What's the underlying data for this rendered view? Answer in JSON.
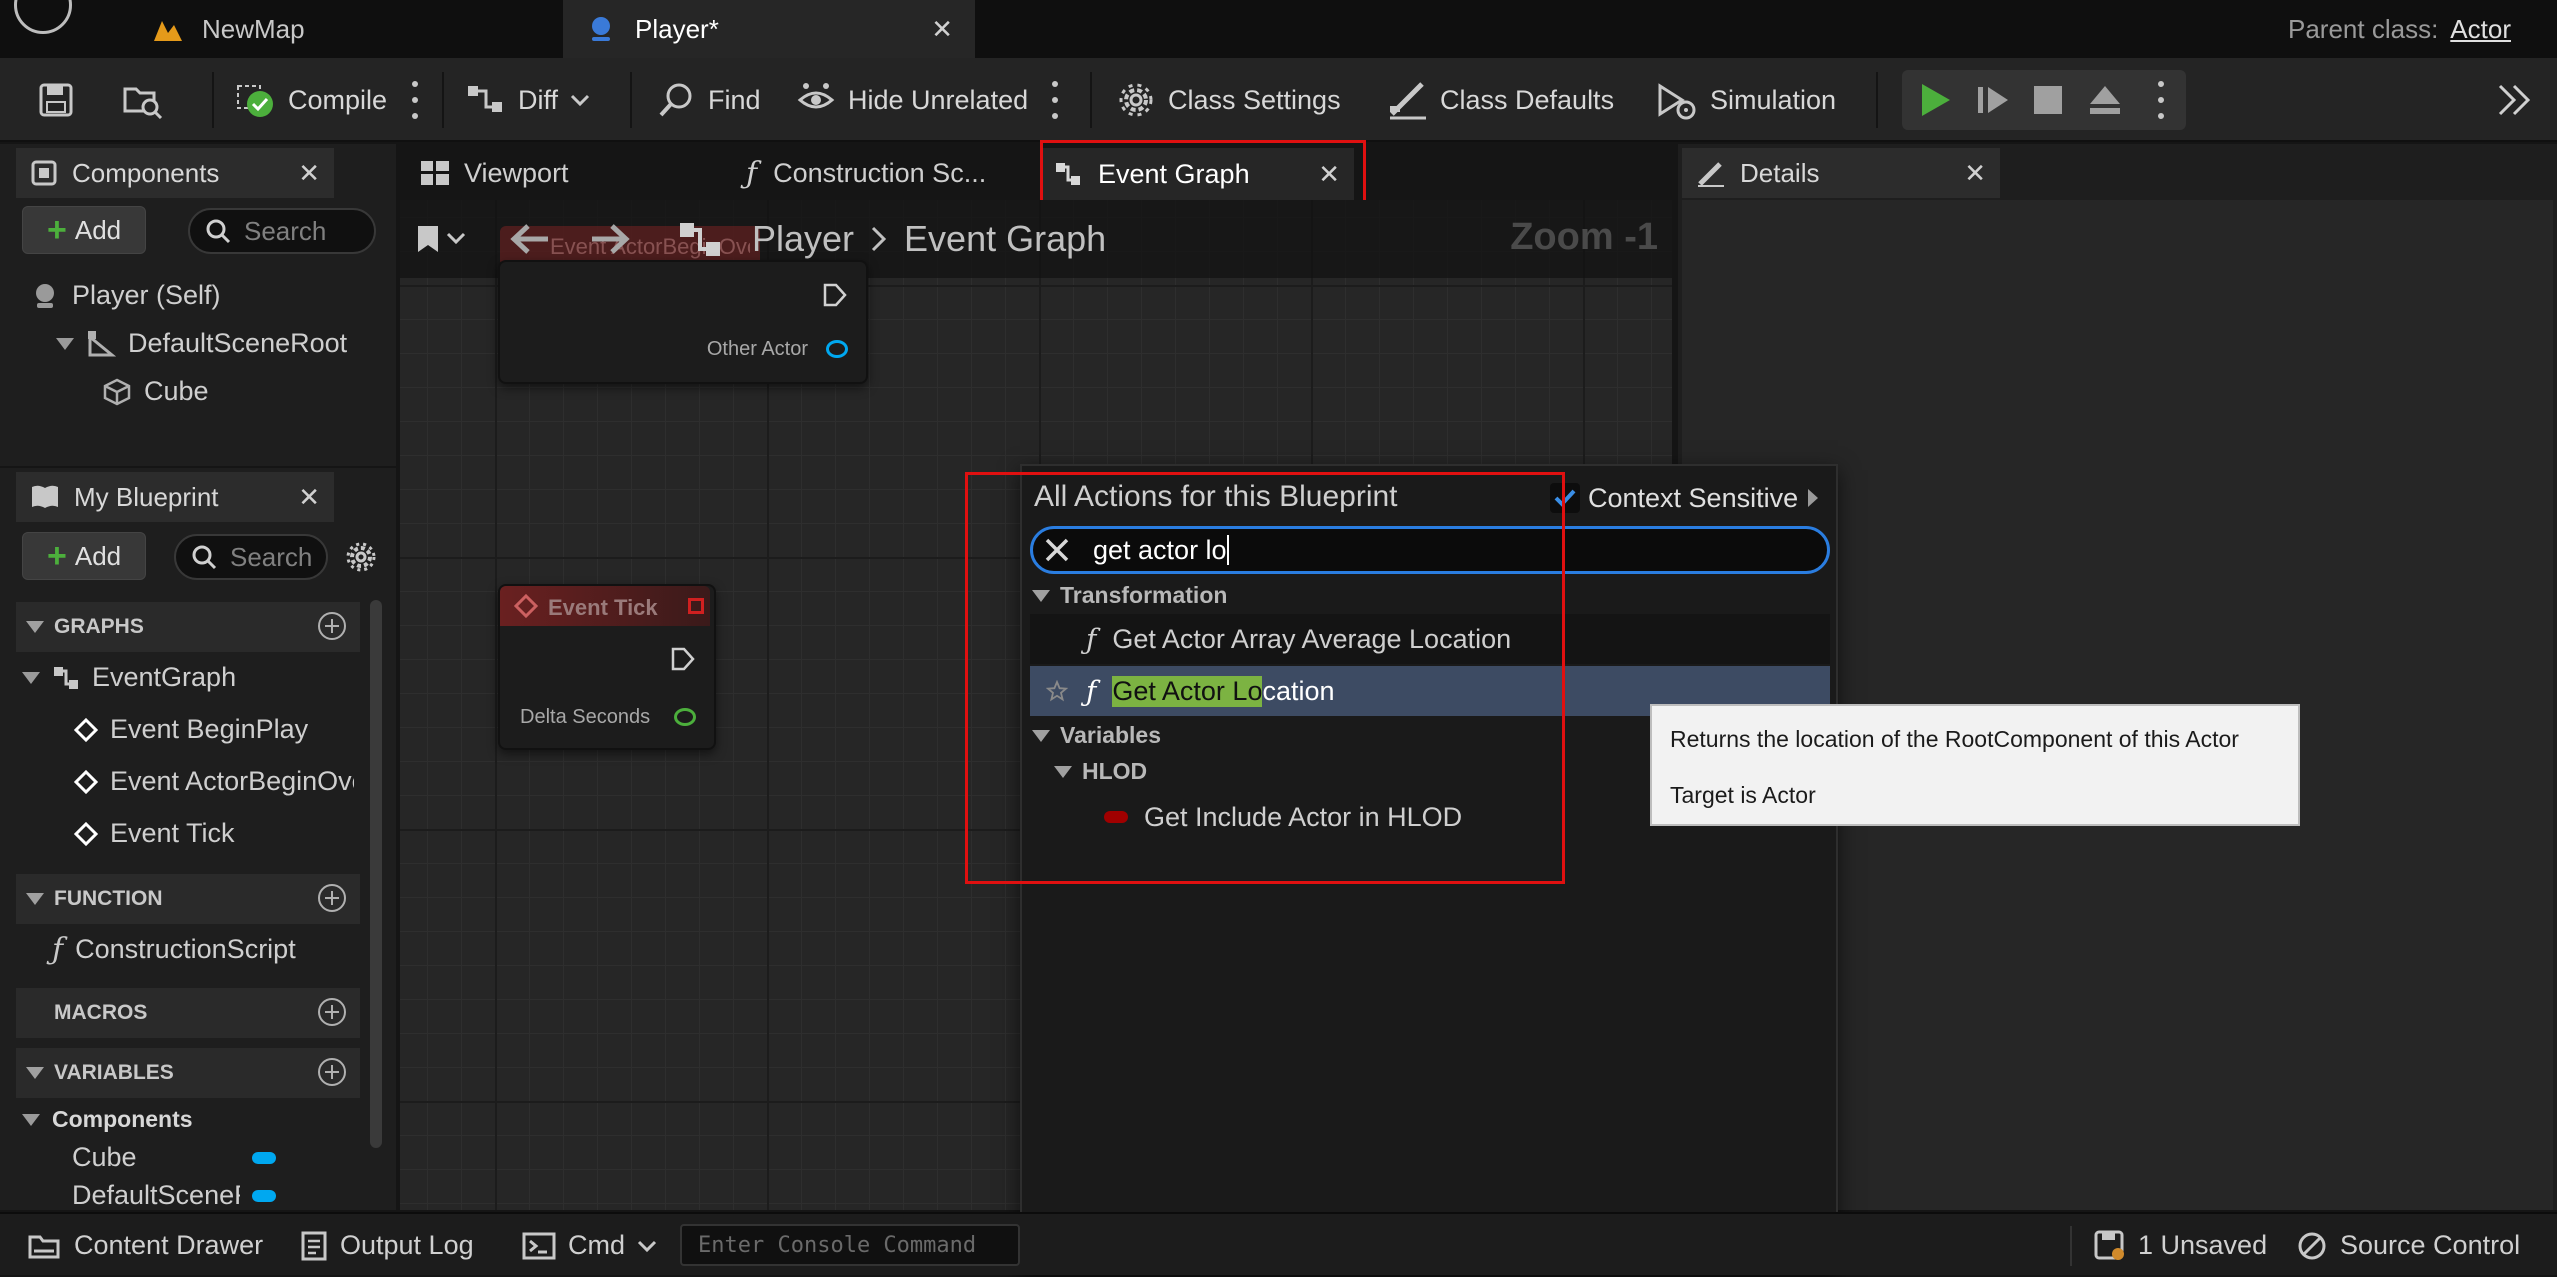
{
  "titlebar": {
    "tabs": [
      {
        "label": "NewMap"
      },
      {
        "label": "Player*"
      }
    ],
    "parent_class_label": "Parent class:",
    "parent_class_value": "Actor"
  },
  "toolbar": {
    "compile": "Compile",
    "diff": "Diff",
    "find": "Find",
    "hide_unrelated": "Hide Unrelated",
    "class_settings": "Class Settings",
    "class_defaults": "Class Defaults",
    "simulation": "Simulation"
  },
  "components_panel": {
    "title": "Components",
    "add_label": "Add",
    "search_placeholder": "Search",
    "tree": [
      "Player (Self)",
      "DefaultSceneRoot",
      "Cube"
    ]
  },
  "editor_tabs": [
    {
      "label": "Viewport"
    },
    {
      "label": "Construction Sc..."
    },
    {
      "label": "Event Graph"
    }
  ],
  "details_panel": {
    "title": "Details"
  },
  "graph": {
    "breadcrumb_root": "Player",
    "breadcrumb_leaf": "Event Graph",
    "zoom": "Zoom -1",
    "ghost_node_label": "Event ActorBeginOverlap",
    "node1_pin": "Other Actor",
    "node2_title": "Event Tick",
    "node2_pin": "Delta Seconds"
  },
  "my_blueprint": {
    "title": "My Blueprint",
    "add_label": "Add",
    "search_placeholder": "Search",
    "sections": {
      "graphs": "GRAPHS",
      "function": "FUNCTION",
      "macros": "MACROS",
      "variables": "VARIABLES"
    },
    "graphs_tree": [
      "EventGraph",
      "Event BeginPlay",
      "Event ActorBeginOverlap",
      "Event Tick"
    ],
    "functions_tree": [
      "ConstructionScript"
    ],
    "variables_category": "Components",
    "variables_tree": [
      "Cube",
      "DefaultSceneRoot"
    ]
  },
  "action_menu": {
    "title": "All Actions for this Blueprint",
    "context_sensitive": "Context Sensitive",
    "search_value": "get actor lo",
    "cat_transformation": "Transformation",
    "item1": "Get Actor Array Average Location",
    "item2_highlight": "Get Actor Lo",
    "item2_rest": "cation",
    "cat_variables": "Variables",
    "subcat_hlod": "HLOD",
    "item3": "Get Include Actor in HLOD"
  },
  "tooltip": {
    "line1": "Returns the location of the RootComponent of this Actor",
    "line2": "Target is Actor"
  },
  "statusbar": {
    "content_drawer": "Content Drawer",
    "output_log": "Output Log",
    "cmd": "Cmd",
    "console_placeholder": "Enter Console Command",
    "unsaved": "1 Unsaved",
    "source_control": "Source Control"
  },
  "colors": {
    "accent_green": "#4caf3c",
    "highlight_green": "#7cb342",
    "selection_blue": "#3d4b63",
    "annotation_red": "#e01010",
    "component_pin_blue": "#00a8f0"
  }
}
